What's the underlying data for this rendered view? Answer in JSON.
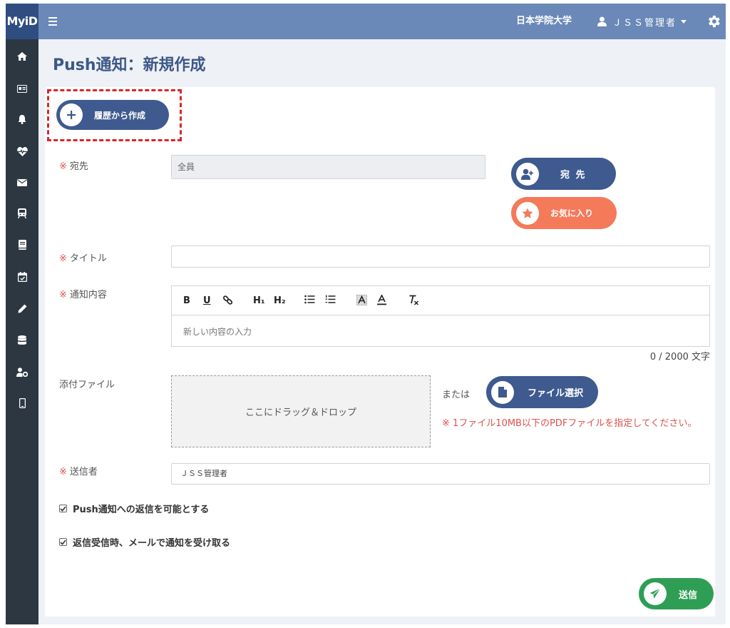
{
  "app": {
    "brand": "MyiD"
  },
  "header": {
    "university": "日本学院大学",
    "user_name": "ＪＳＳ管理者"
  },
  "page": {
    "title": "Push通知：新規作成"
  },
  "form": {
    "history_button": "履歴から作成",
    "recipient": {
      "label": "宛先",
      "value": "全員",
      "button": "宛 先",
      "favorite_button": "お気に入り"
    },
    "title": {
      "label": "タイトル",
      "value": ""
    },
    "content": {
      "label": "通知内容",
      "placeholder": "新しい内容の入力",
      "counter": "0 / 2000 文字",
      "toolbar": {
        "bold": "B",
        "underline": "U",
        "h1": "H₁",
        "h2": "H₂"
      }
    },
    "attachment": {
      "label": "添付ファイル",
      "dropzone": "ここにドラッグ＆ドロップ",
      "or": "または",
      "button": "ファイル選択",
      "note": "※ 1ファイル10MB以下のPDFファイルを指定してください。"
    },
    "sender": {
      "label": "送信者",
      "value": "ＪＳＳ管理者"
    },
    "checkboxes": [
      {
        "label": "Push通知への返信を可能とする",
        "checked": true
      },
      {
        "label": "返信受信時、メールで通知を受け取る",
        "checked": true
      }
    ],
    "required_mark": "※",
    "send_button": "送信"
  },
  "colors": {
    "header": "#6a88b8",
    "brand": "#2f4d80",
    "sidebar": "#2c3742",
    "primary_button": "#3e5a8f",
    "favorite_button": "#f47a5a",
    "send_button": "#2e9e55",
    "required": "#d9534f",
    "highlight": "#d9262a"
  },
  "icons": {
    "sidebar": [
      "home-icon",
      "id-card-icon",
      "bell-icon",
      "heartbeat-icon",
      "envelope-icon",
      "train-icon",
      "book-icon",
      "calendar-check-icon",
      "pencil-icon",
      "database-icon",
      "user-cog-icon",
      "mobile-icon"
    ]
  }
}
